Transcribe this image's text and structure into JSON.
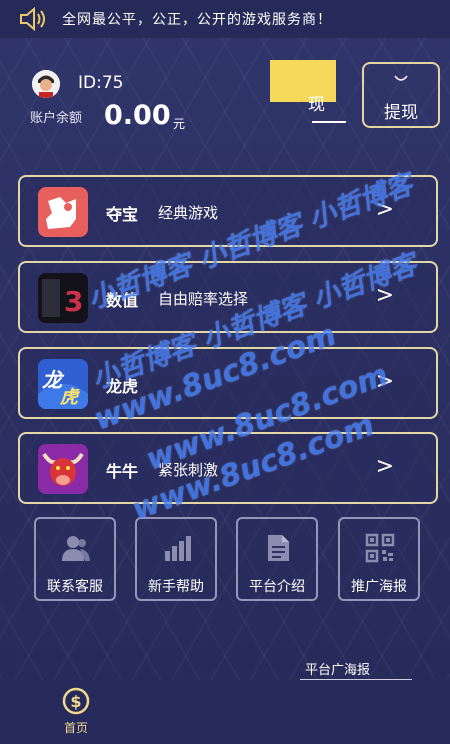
{
  "notice": {
    "icon": "speaker-icon",
    "text": "全网最公平，公正，公开的游戏服务商！"
  },
  "account": {
    "id": "ID:75",
    "balance_label": "账户余额",
    "balance": "0.00",
    "unit": "元",
    "recharge_label": "现",
    "withdraw_label": "提现"
  },
  "games": [
    {
      "name": "夺宝",
      "desc": "经典游戏",
      "icon": "treasure-icon",
      "arrow": ">"
    },
    {
      "name": "数值",
      "desc": "自由赔率选择",
      "icon": "number-icon",
      "arrow": ">"
    },
    {
      "name": "龙虎",
      "desc": "",
      "icon": "dragon-tiger-icon",
      "arrow": ">"
    },
    {
      "name": "牛牛",
      "desc": "紧张刺激",
      "icon": "bull-icon",
      "arrow": ">"
    }
  ],
  "shortcuts": [
    {
      "label": "联系客服",
      "icon": "customer-service-icon"
    },
    {
      "label": "新手帮助",
      "icon": "bar-chart-icon"
    },
    {
      "label": "平台介绍",
      "icon": "document-icon"
    },
    {
      "label": "推广海报",
      "icon": "qr-code-icon"
    }
  ],
  "platform_link": "平台广海报",
  "tabbar": {
    "home_label": "首页",
    "home_icon": "dollar-coin-icon"
  },
  "watermark": {
    "line1": "小哲博客 小哲博客 小哲博客",
    "line2": "小哲博客 小哲博客 小哲博客",
    "line3": "www.8uc8.com",
    "line4": "www.8uc8.com",
    "line5": "www.8uc8.com"
  },
  "colors": {
    "background": "#2b2f63",
    "card_border": "#e3d7a5",
    "accent_gold": "#f0d98d",
    "watermark": "#4a86ff"
  }
}
